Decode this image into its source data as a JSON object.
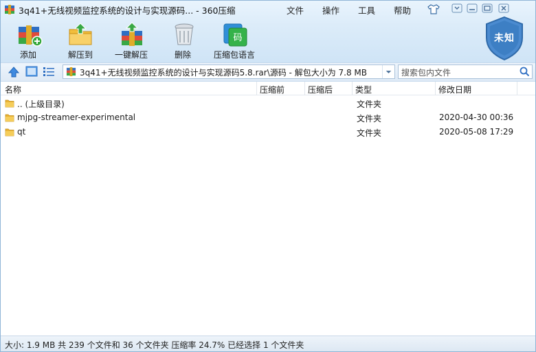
{
  "window": {
    "title": "3q41+无线视频监控系统的设计与实现源码... - 360压缩"
  },
  "menu": {
    "file": "文件",
    "operation": "操作",
    "tools": "工具",
    "help": "帮助"
  },
  "toolbar": {
    "add": "添加",
    "extract_to": "解压到",
    "one_click_extract": "一键解压",
    "delete": "删除",
    "encoding": "压缩包语言"
  },
  "security_badge": "未知",
  "address": {
    "path": "3q41+无线视频监控系统的设计与实现源码5.8.rar\\源码 - 解包大小为 7.8 MB"
  },
  "search": {
    "placeholder": "搜索包内文件"
  },
  "columns": {
    "name": "名称",
    "compressed": "压缩前",
    "after": "压缩后",
    "type": "类型",
    "modified": "修改日期"
  },
  "rows": [
    {
      "name": ".. (上级目录)",
      "type": "文件夹",
      "date": ""
    },
    {
      "name": "mjpg-streamer-experimental",
      "type": "文件夹",
      "date": "2020-04-30 00:36"
    },
    {
      "name": "qt",
      "type": "文件夹",
      "date": "2020-05-08 17:29"
    }
  ],
  "status": {
    "text": "大小: 1.9 MB 共 239 个文件和 36 个文件夹 压缩率 24.7% 已经选择 1 个文件夹"
  },
  "colors": {
    "accent": "#2f7fd0",
    "folder": "#e9b233",
    "shield": "#3d7fc4"
  }
}
